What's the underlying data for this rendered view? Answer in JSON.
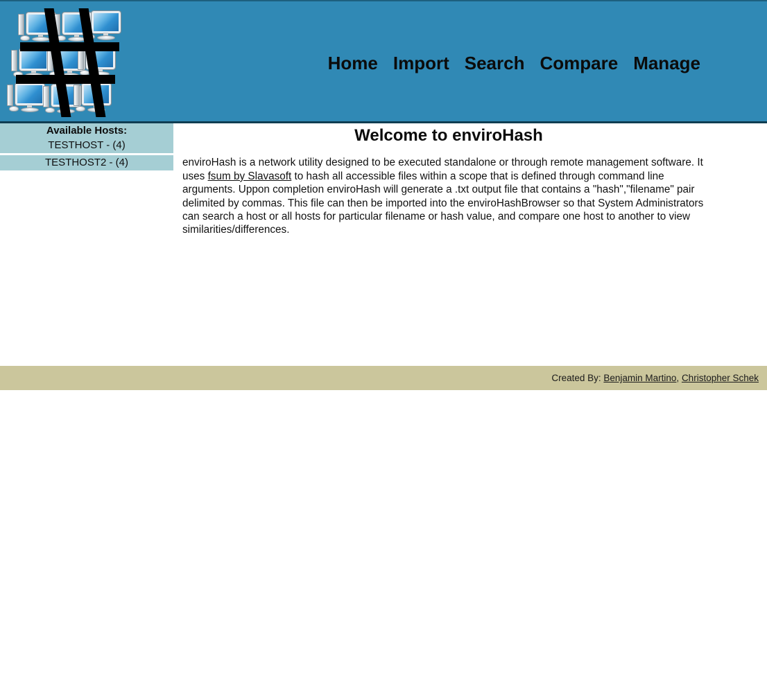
{
  "header": {
    "logo": {
      "icon": "hash-network-logo",
      "alt": "enviroHash logo: hash symbol over grid of computer monitors",
      "monitor_count": 9
    },
    "nav": [
      {
        "label": "Home",
        "name": "nav-home"
      },
      {
        "label": "Import",
        "name": "nav-import"
      },
      {
        "label": "Search",
        "name": "nav-search"
      },
      {
        "label": "Compare",
        "name": "nav-compare"
      },
      {
        "label": "Manage",
        "name": "nav-manage"
      }
    ]
  },
  "sidebar": {
    "title": "Available Hosts:",
    "hosts": [
      {
        "label": "TESTHOST - (4)",
        "name": "TESTHOST",
        "file_count": 4
      },
      {
        "label": "TESTHOST2 - (4)",
        "name": "TESTHOST2",
        "file_count": 4
      }
    ]
  },
  "main": {
    "title": "Welcome to enviroHash",
    "paragraph": {
      "part1": "enviroHash is a network utility designed to be executed standalone or through remote management software. It uses ",
      "link_text": "fsum by Slavasoft",
      "part2": " to hash all accessible files within a scope that is defined through command line arguments. Uppon completion enviroHash will generate a .txt output file that contains a \"hash\",\"filename\" pair delimited by commas. This file can then be imported into the enviroHashBrowser so that System Administrators can search a host or all hosts for particular filename or hash value, and compare one host to another to view similarities/differences."
    }
  },
  "footer": {
    "prefix": "Created By: ",
    "author1": "Benjamin Martino",
    "separator": ", ",
    "author2": "Christopher Schek"
  },
  "colors": {
    "header_blue": "#3089b5",
    "header_border": "#0f3d52",
    "sidebar_teal": "#a5ced4",
    "footer_tan": "#cbc69c",
    "text_dark": "#111111",
    "logo_bar_black": "#000000"
  }
}
